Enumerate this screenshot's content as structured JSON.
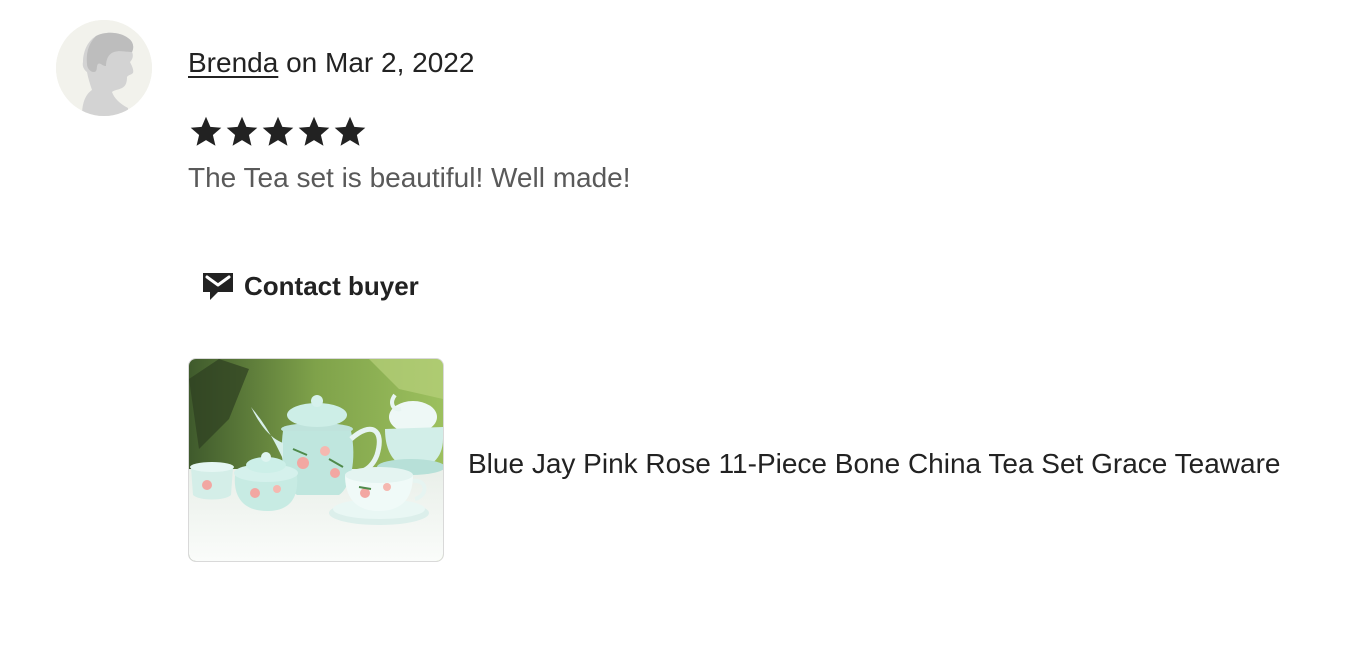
{
  "review": {
    "reviewer_name": "Brenda",
    "date_text": " on Mar 2, 2022",
    "rating": 5,
    "rating_max": 5,
    "text": "The Tea set is beautiful! Well made!"
  },
  "actions": {
    "contact_label": "Contact buyer",
    "contact_icon": "message-icon"
  },
  "product": {
    "title": "Blue Jay Pink Rose 11-Piece Bone China Tea Set Grace Teaware"
  },
  "colors": {
    "text": "#222222",
    "muted_text": "#595959",
    "star": "#222222",
    "avatar_bg": "#f2f2ec"
  }
}
